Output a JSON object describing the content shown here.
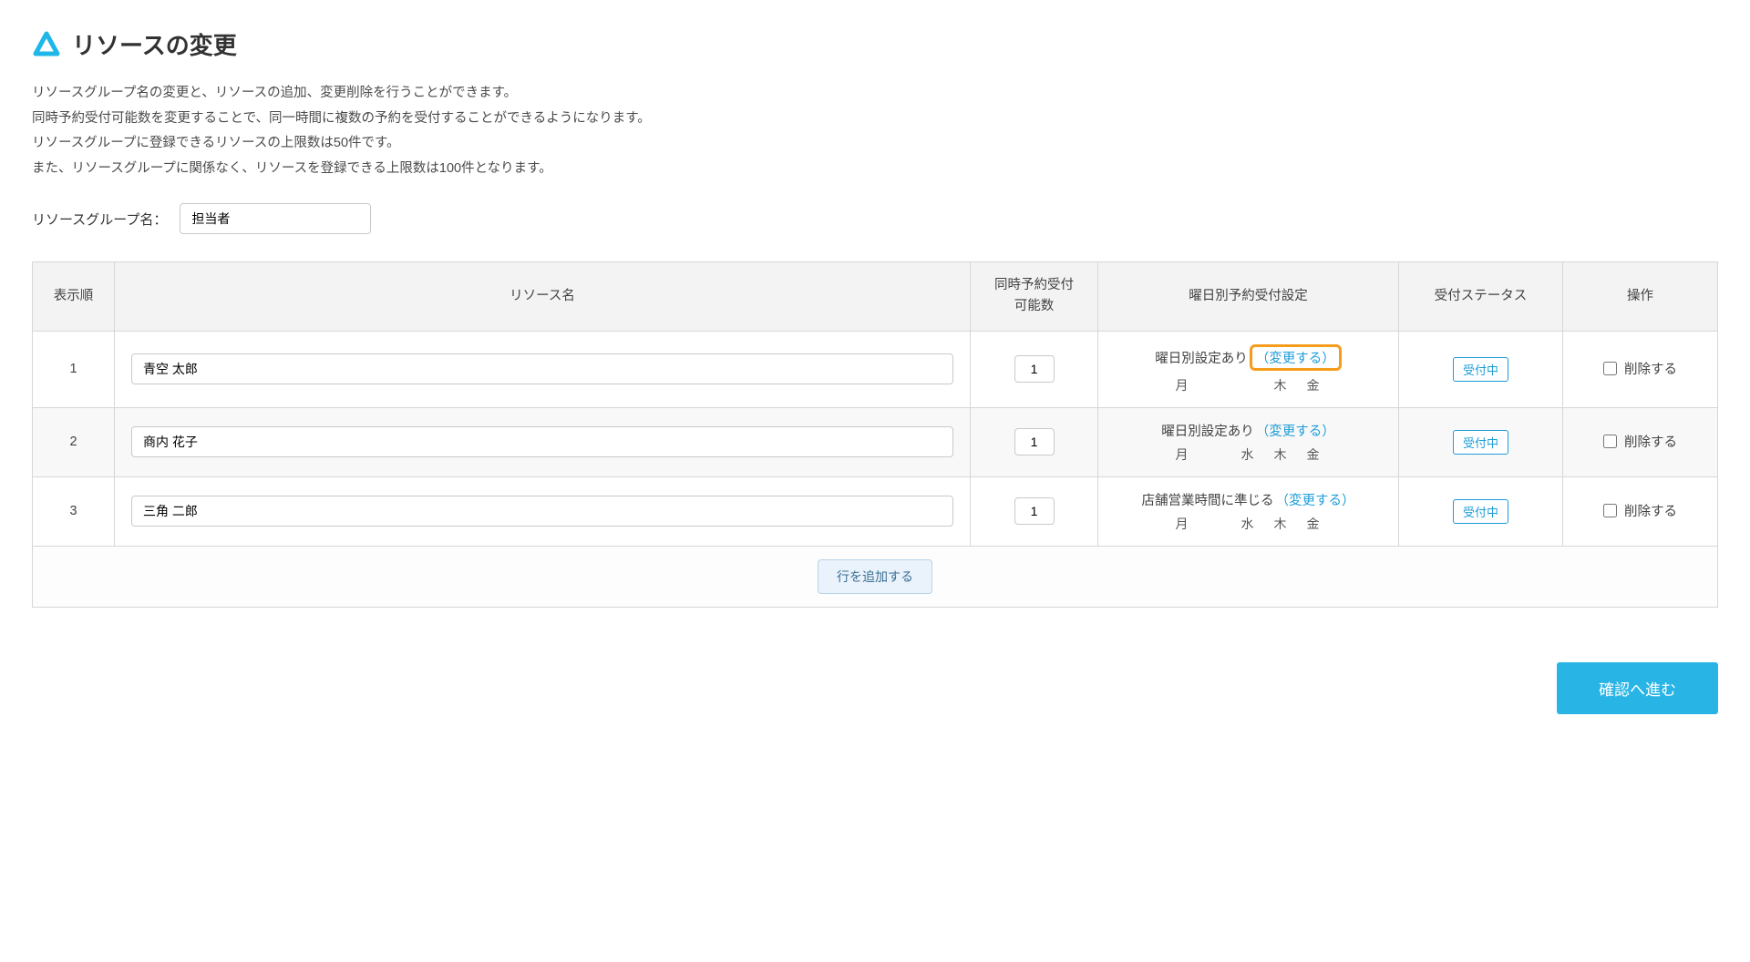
{
  "header": {
    "title": "リソースの変更"
  },
  "description": {
    "line1": "リソースグループ名の変更と、リソースの追加、変更削除を行うことができます。",
    "line2": "同時予約受付可能数を変更することで、同一時間に複数の予約を受付することができるようになります。",
    "line3": "リソースグループに登録できるリソースの上限数は50件です。",
    "line4": "また、リソースグループに関係なく、リソースを登録できる上限数は100件となります。"
  },
  "group": {
    "label": "リソースグループ名：",
    "value": "担当者"
  },
  "table": {
    "headers": {
      "order": "表示順",
      "name": "リソース名",
      "count_line1": "同時予約受付",
      "count_line2": "可能数",
      "day": "曜日別予約受付設定",
      "status": "受付ステータス",
      "ops": "操作"
    },
    "change_label": "変更する",
    "delete_label": "削除する",
    "rows": [
      {
        "order": "1",
        "name": "青空 太郎",
        "count": "1",
        "day_title": "曜日別設定あり",
        "highlight_change": true,
        "days": {
          "mon": "月",
          "tue": "",
          "wed": "",
          "thu": "木",
          "fri": "金"
        },
        "status": "受付中"
      },
      {
        "order": "2",
        "name": "商内 花子",
        "count": "1",
        "day_title": "曜日別設定あり",
        "highlight_change": false,
        "days": {
          "mon": "月",
          "tue": "",
          "wed": "水",
          "thu": "木",
          "fri": "金"
        },
        "status": "受付中"
      },
      {
        "order": "3",
        "name": "三角 二郎",
        "count": "1",
        "day_title": "店舗営業時間に準じる",
        "highlight_change": false,
        "days": {
          "mon": "月",
          "tue": "",
          "wed": "水",
          "thu": "木",
          "fri": "金"
        },
        "status": "受付中"
      }
    ]
  },
  "buttons": {
    "add_row": "行を追加する",
    "proceed": "確認へ進む"
  }
}
